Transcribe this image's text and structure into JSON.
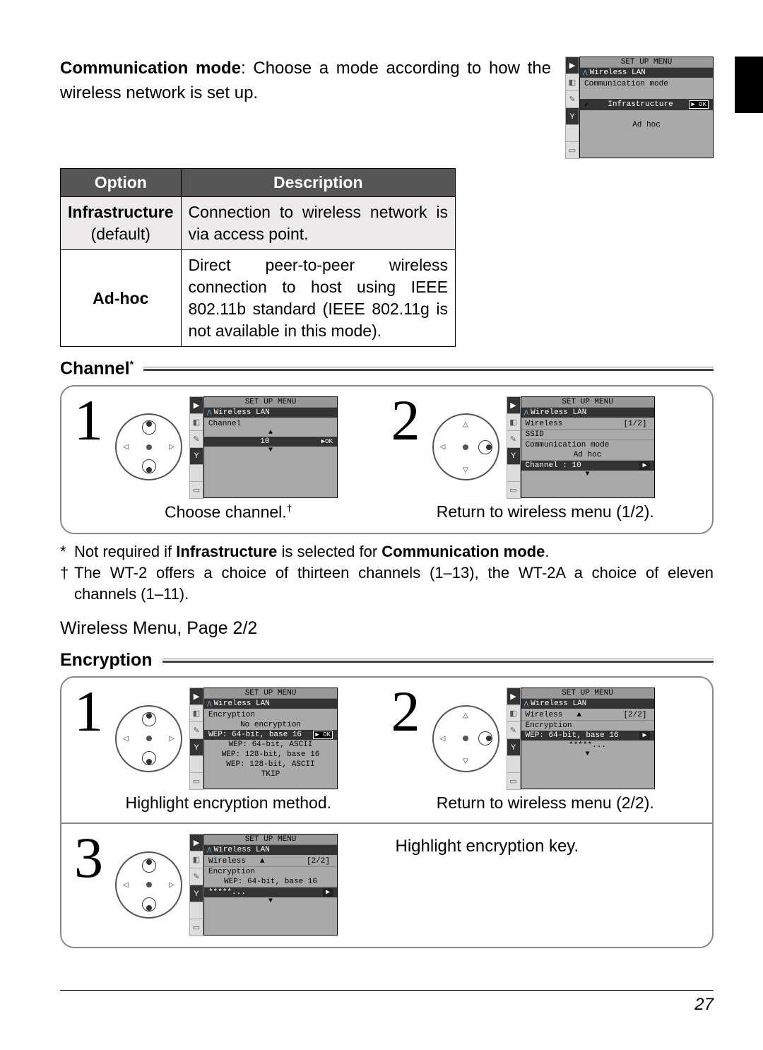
{
  "intro": {
    "heading_bold": "Communication mode",
    "heading_rest": ": Choose a mode according to how the wireless network is set up."
  },
  "table": {
    "headers": {
      "option": "Option",
      "desc": "Description"
    },
    "rows": [
      {
        "opt_bold": "Infrastructure",
        "opt_sub": "(default)",
        "desc": "Connection to wireless network is via access point."
      },
      {
        "opt_bold": "Ad-hoc",
        "opt_sub": "",
        "desc": "Direct peer-to-peer wireless connection to host using IEEE 802.11b standard (IEEE 802.11g is not available in this mode)."
      }
    ]
  },
  "lcd_common": {
    "set_up_menu": "SET UP MENU",
    "wireless_lan": "Wireless LAN",
    "ok_label": "▶ OK"
  },
  "lcd_mode": {
    "title": "Communication mode",
    "opt1": "Infrastructure",
    "opt2": "Ad hoc"
  },
  "section_channel": {
    "title": "Channel",
    "sup": "*",
    "step1": {
      "menu_item": "Channel",
      "value": "10",
      "caption": "Choose channel.",
      "caption_sup": "†"
    },
    "step2": {
      "menu_title": "Wireless",
      "page": "[1/2]",
      "items": {
        "ssid": "SSID",
        "comm": "Communication mode",
        "comm_val": "Ad hoc",
        "channel": "Channel  :  10"
      },
      "caption": "Return to wireless menu (1/2)."
    }
  },
  "footnotes": {
    "f1_pre": "Not required if ",
    "f1_b1": "Infrastructure",
    "f1_mid": " is selected for ",
    "f1_b2": "Communication mode",
    "f1_end": ".",
    "f2": "The WT-2 offers a choice of thirteen channels (1–13), the WT-2A a choice of eleven channels (1–11)."
  },
  "subheader": "Wireless Menu, Page 2/2",
  "section_enc": {
    "title": "Encryption",
    "step1": {
      "menu_item": "Encryption",
      "options": [
        "No encryption",
        "WEP: 64-bit, base 16",
        "WEP: 64-bit, ASCII",
        "WEP: 128-bit, base 16",
        "WEP: 128-bit, ASCII",
        "TKIP"
      ],
      "selected_index": 1,
      "caption": "Highlight encryption method."
    },
    "step2": {
      "menu_title": "Wireless",
      "page": "[2/2]",
      "enc_label": "Encryption",
      "enc_val": "WEP: 64-bit, base 16",
      "key_val": "*****...",
      "caption": "Return to wireless menu (2/2)."
    },
    "step3": {
      "caption": "Highlight encryption key."
    }
  },
  "page_number": "27"
}
